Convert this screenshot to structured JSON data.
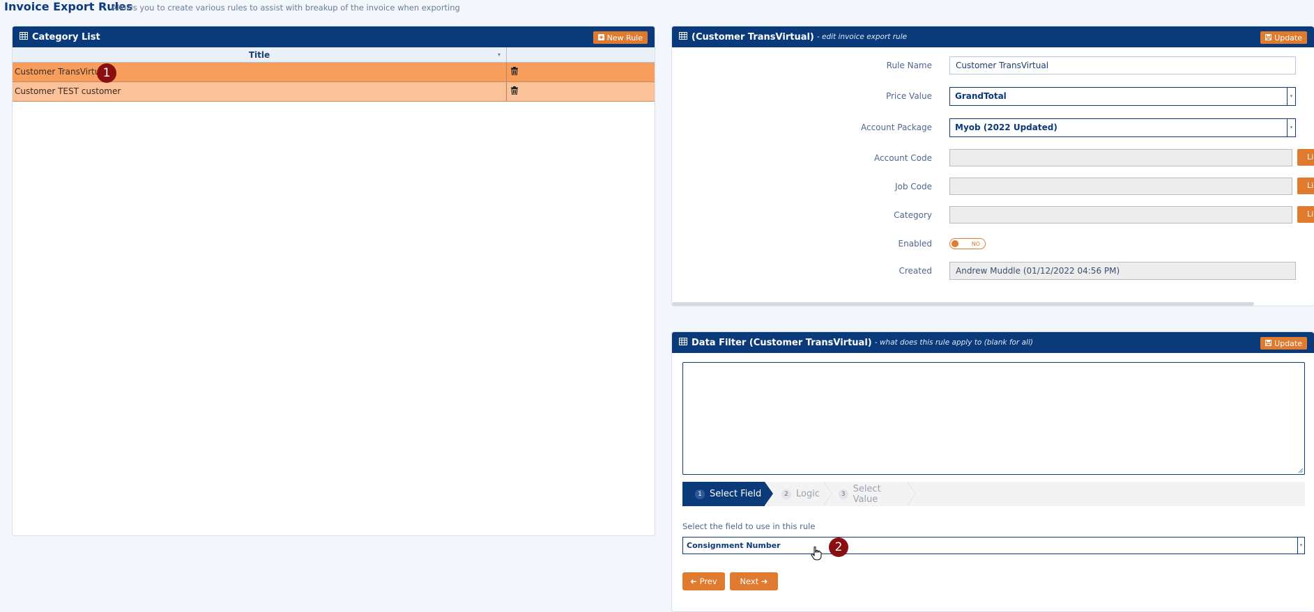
{
  "page": {
    "title": "Invoice Export Rules",
    "subtitle": "Allows you to create various rules to assist with breakup of the invoice when exporting"
  },
  "category_list": {
    "title": "Category List",
    "new_rule_label": "New Rule",
    "column_title": "Title",
    "rows": [
      {
        "title": "Customer TransVirtual",
        "selected": true
      },
      {
        "title": "Customer TEST customer",
        "selected": false
      }
    ]
  },
  "rule_panel": {
    "title": "(Customer TransVirtual)",
    "subtitle": "- edit invoice export rule",
    "update_label": "Update",
    "fields": {
      "rule_name_label": "Rule Name",
      "rule_name_value": "Customer TransVirtual",
      "price_value_label": "Price Value",
      "price_value_value": "GrandTotal",
      "account_package_label": "Account Package",
      "account_package_value": "Myob (2022 Updated)",
      "account_code_label": "Account Code",
      "account_code_value": "",
      "job_code_label": "Job Code",
      "job_code_value": "",
      "category_label": "Category",
      "category_value": "",
      "lookup_label": "Li",
      "enabled_label": "Enabled",
      "enabled_state": "NO",
      "created_label": "Created",
      "created_value": "Andrew Muddle (01/12/2022 04:56 PM)"
    }
  },
  "data_filter": {
    "title": "Data Filter (Customer TransVirtual)",
    "subtitle": "- what does this rule apply to (blank for all)",
    "update_label": "Update",
    "steps": [
      {
        "num": "1",
        "label": "Select Field",
        "active": true
      },
      {
        "num": "2",
        "label": "Logic",
        "active": false
      },
      {
        "num": "3",
        "label": "Select Value",
        "active": false
      }
    ],
    "field_prompt": "Select the field to use in this rule",
    "field_value": "Consignment Number",
    "prev_label": "Prev",
    "next_label": "Next"
  },
  "annotations": {
    "badge_1": "1",
    "badge_2": "2"
  },
  "colors": {
    "navy": "#0b3a7a",
    "orange": "#e07a2f",
    "row_selected": "#f89e5c",
    "row_alt": "#fbc198",
    "badge": "#8b0f10"
  }
}
